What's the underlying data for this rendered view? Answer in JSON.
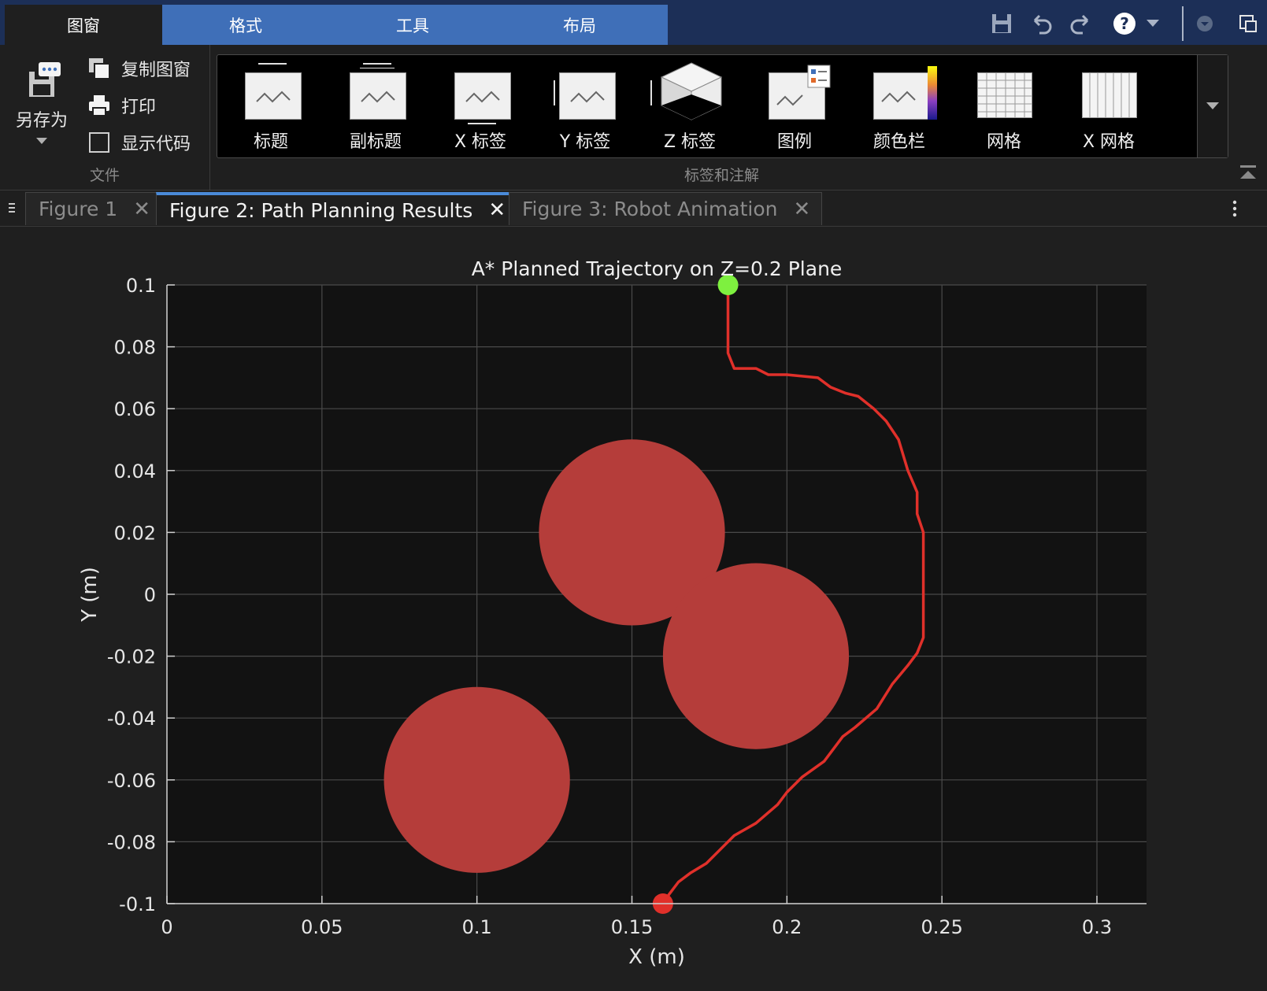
{
  "ribbon_tabs": [
    "图窗",
    "格式",
    "工具",
    "布局"
  ],
  "quick_access": {
    "save_icon": "save-icon",
    "undo_icon": "undo-icon",
    "redo_icon": "redo-icon",
    "help_icon": "help-icon",
    "dropdown_icon": "dropdown-icon",
    "window_icon": "window-icon"
  },
  "file_section": {
    "save_as": "另存为",
    "copy_figure": "复制图窗",
    "print": "打印",
    "show_code": "显示代码",
    "show_code_checked": false,
    "title": "文件"
  },
  "annotation_section": {
    "title": "标签和注解",
    "items": [
      "标题",
      "副标题",
      "X 标签",
      "Y 标签",
      "Z 标签",
      "图例",
      "颜色栏",
      "网格",
      "X 网格"
    ]
  },
  "figure_tabs": [
    {
      "label": "Figure 1",
      "active": false
    },
    {
      "label": "Figure 2: Path Planning Results",
      "active": true
    },
    {
      "label": "Figure 3: Robot Animation",
      "active": false
    }
  ],
  "chart_data": {
    "type": "line",
    "title": "A* Planned Trajectory on Z=0.2 Plane",
    "xlabel": "X (m)",
    "ylabel": "Y (m)",
    "xlim": [
      0,
      0.316
    ],
    "ylim": [
      -0.1,
      0.1
    ],
    "xticks": [
      0,
      0.05,
      0.1,
      0.15,
      0.2,
      0.25,
      0.3
    ],
    "xtick_labels": [
      "0",
      "0.05",
      "0.1",
      "0.15",
      "0.2",
      "0.25",
      "0.3"
    ],
    "yticks": [
      -0.1,
      -0.08,
      -0.06,
      -0.04,
      -0.02,
      0,
      0.02,
      0.04,
      0.06,
      0.08,
      0.1
    ],
    "ytick_labels": [
      "-0.1",
      "-0.08",
      "-0.06",
      "-0.04",
      "-0.02",
      "0",
      "0.02",
      "0.04",
      "0.06",
      "0.08",
      "0.1"
    ],
    "grid": true,
    "background": "#121212",
    "obstacles": [
      {
        "cx": 0.15,
        "cy": 0.02,
        "r": 0.03
      },
      {
        "cx": 0.19,
        "cy": -0.02,
        "r": 0.03
      },
      {
        "cx": 0.1,
        "cy": -0.06,
        "r": 0.03
      }
    ],
    "obstacle_color": "#b53d3a",
    "path_color": "#e0302a",
    "path": [
      [
        0.16,
        -0.1
      ],
      [
        0.162,
        -0.097
      ],
      [
        0.165,
        -0.093
      ],
      [
        0.169,
        -0.09
      ],
      [
        0.174,
        -0.087
      ],
      [
        0.178,
        -0.083
      ],
      [
        0.183,
        -0.078
      ],
      [
        0.19,
        -0.074
      ],
      [
        0.197,
        -0.068
      ],
      [
        0.2,
        -0.064
      ],
      [
        0.205,
        -0.059
      ],
      [
        0.212,
        -0.054
      ],
      [
        0.218,
        -0.046
      ],
      [
        0.222,
        -0.043
      ],
      [
        0.229,
        -0.037
      ],
      [
        0.234,
        -0.029
      ],
      [
        0.239,
        -0.023
      ],
      [
        0.242,
        -0.019
      ],
      [
        0.244,
        -0.014
      ],
      [
        0.244,
        0.02
      ],
      [
        0.242,
        0.026
      ],
      [
        0.242,
        0.033
      ],
      [
        0.239,
        0.04
      ],
      [
        0.236,
        0.05
      ],
      [
        0.232,
        0.056
      ],
      [
        0.228,
        0.06
      ],
      [
        0.223,
        0.064
      ],
      [
        0.219,
        0.065
      ],
      [
        0.214,
        0.067
      ],
      [
        0.21,
        0.07
      ],
      [
        0.2,
        0.071
      ],
      [
        0.194,
        0.071
      ],
      [
        0.19,
        0.073
      ],
      [
        0.183,
        0.073
      ],
      [
        0.181,
        0.078
      ],
      [
        0.181,
        0.1
      ]
    ],
    "start": {
      "x": 0.181,
      "y": 0.1,
      "color": "#7ef03f"
    },
    "end": {
      "x": 0.16,
      "y": -0.1,
      "color": "#e0302a"
    }
  }
}
